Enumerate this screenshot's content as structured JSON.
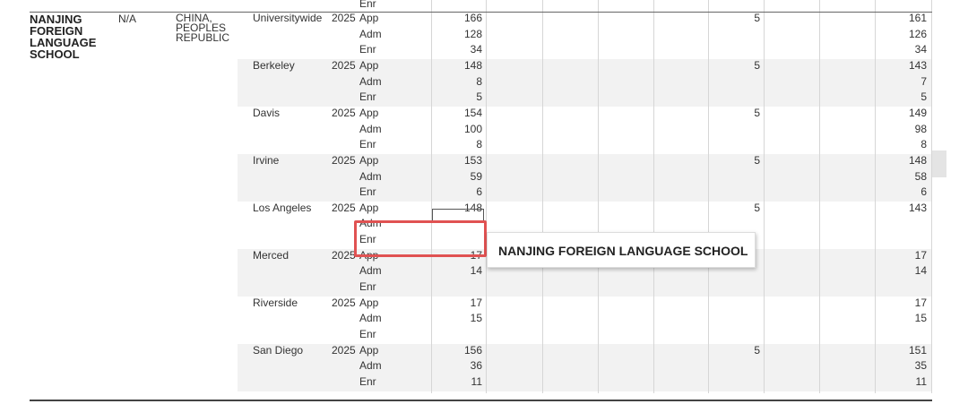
{
  "top_row": {
    "metric": "Enr"
  },
  "school": {
    "name": "NANJING\nFOREIGN\nLANGUAGE\nSCHOOL",
    "code": "N/A",
    "country": "CHINA,\nPEOPLES\nREPUBLIC"
  },
  "campuses": [
    {
      "name": "Universitywide",
      "year": "2025",
      "metrics": [
        {
          "label": "App",
          "total": "166",
          "col6": "5",
          "col8": "161"
        },
        {
          "label": "Adm",
          "total": "128",
          "col6": "",
          "col8": "126"
        },
        {
          "label": "Enr",
          "total": "34",
          "col6": "",
          "col8": "34"
        }
      ]
    },
    {
      "name": "Berkeley",
      "year": "2025",
      "metrics": [
        {
          "label": "App",
          "total": "148",
          "col6": "5",
          "col8": "143"
        },
        {
          "label": "Adm",
          "total": "8",
          "col6": "",
          "col8": "7"
        },
        {
          "label": "Enr",
          "total": "5",
          "col6": "",
          "col8": "5"
        }
      ]
    },
    {
      "name": "Davis",
      "year": "2025",
      "metrics": [
        {
          "label": "App",
          "total": "154",
          "col6": "5",
          "col8": "149"
        },
        {
          "label": "Adm",
          "total": "100",
          "col6": "",
          "col8": "98"
        },
        {
          "label": "Enr",
          "total": "8",
          "col6": "",
          "col8": "8"
        }
      ]
    },
    {
      "name": "Irvine",
      "year": "2025",
      "metrics": [
        {
          "label": "App",
          "total": "153",
          "col6": "5",
          "col8": "148"
        },
        {
          "label": "Adm",
          "total": "59",
          "col6": "",
          "col8": "58"
        },
        {
          "label": "Enr",
          "total": "6",
          "col6": "",
          "col8": "6"
        }
      ]
    },
    {
      "name": "Los Angeles",
      "year": "2025",
      "metrics": [
        {
          "label": "App",
          "total": "148",
          "col6": "5",
          "col8": "143"
        },
        {
          "label": "Adm",
          "total": "",
          "col6": "",
          "col8": ""
        },
        {
          "label": "Enr",
          "total": "",
          "col6": "",
          "col8": ""
        }
      ]
    },
    {
      "name": "Merced",
      "year": "2025",
      "metrics": [
        {
          "label": "App",
          "total": "17",
          "col6": "",
          "col8": "17"
        },
        {
          "label": "Adm",
          "total": "14",
          "col6": "",
          "col8": "14"
        },
        {
          "label": "Enr",
          "total": "",
          "col6": "",
          "col8": ""
        }
      ]
    },
    {
      "name": "Riverside",
      "year": "2025",
      "metrics": [
        {
          "label": "App",
          "total": "17",
          "col6": "",
          "col8": "17"
        },
        {
          "label": "Adm",
          "total": "15",
          "col6": "",
          "col8": "15"
        },
        {
          "label": "Enr",
          "total": "",
          "col6": "",
          "col8": ""
        }
      ]
    },
    {
      "name": "San Diego",
      "year": "2025",
      "metrics": [
        {
          "label": "App",
          "total": "156",
          "col6": "5",
          "col8": "151"
        },
        {
          "label": "Adm",
          "total": "36",
          "col6": "",
          "col8": "35"
        },
        {
          "label": "Enr",
          "total": "11",
          "col6": "",
          "col8": "11"
        }
      ]
    }
  ],
  "tooltip": {
    "text": "NANJING FOREIGN LANGUAGE SCHOOL"
  },
  "colors": {
    "band": "#f2f2f2",
    "highlight": "#e05252",
    "grid": "#d6d6d6"
  }
}
